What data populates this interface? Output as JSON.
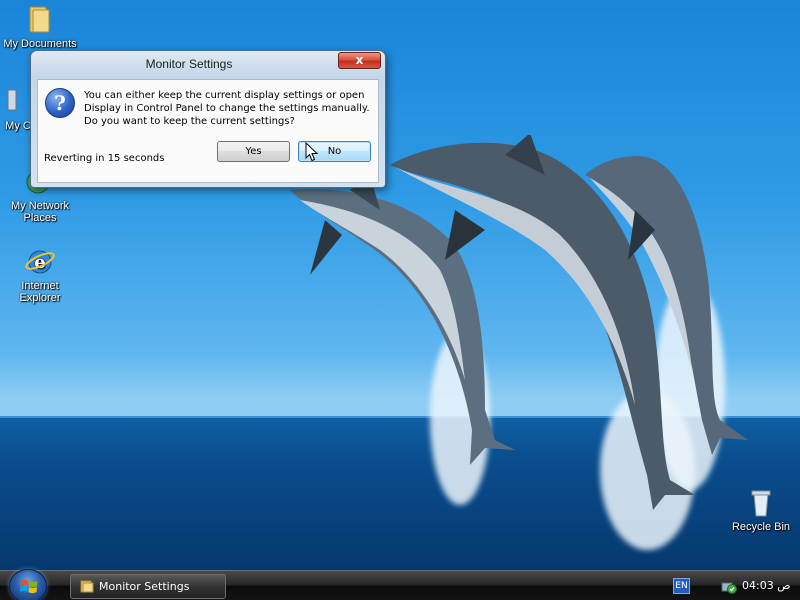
{
  "desktop": {
    "icons": [
      {
        "label_line1": "My Documents",
        "label_line2": ""
      },
      {
        "label_line1": "My C",
        "label_line2": ""
      },
      {
        "label_line1": "My Network",
        "label_line2": "Places"
      },
      {
        "label_line1": "Internet",
        "label_line2": "Explorer"
      }
    ],
    "recycle_bin": {
      "label": "Recycle Bin"
    }
  },
  "dialog": {
    "title": "Monitor Settings",
    "close_glyph": "x",
    "icon": "question-icon",
    "message_lines": [
      "You can either keep the current display settings or open",
      "Display in Control Panel to change the settings manually.",
      "Do you want to keep the current settings?"
    ],
    "revert_text": "Reverting in 15 seconds",
    "buttons": {
      "yes": "Yes",
      "no": "No"
    },
    "focused_button": "No"
  },
  "taskbar": {
    "start_icon": "windows-flag-icon",
    "task_button_label": "Monitor Settings",
    "language": "EN",
    "clock": "04:03 ص"
  },
  "colors": {
    "sky": "#2f9be6",
    "sea": "#0a4c8c",
    "close_button": "#d9523d",
    "focused_button": "#bee6fd"
  }
}
